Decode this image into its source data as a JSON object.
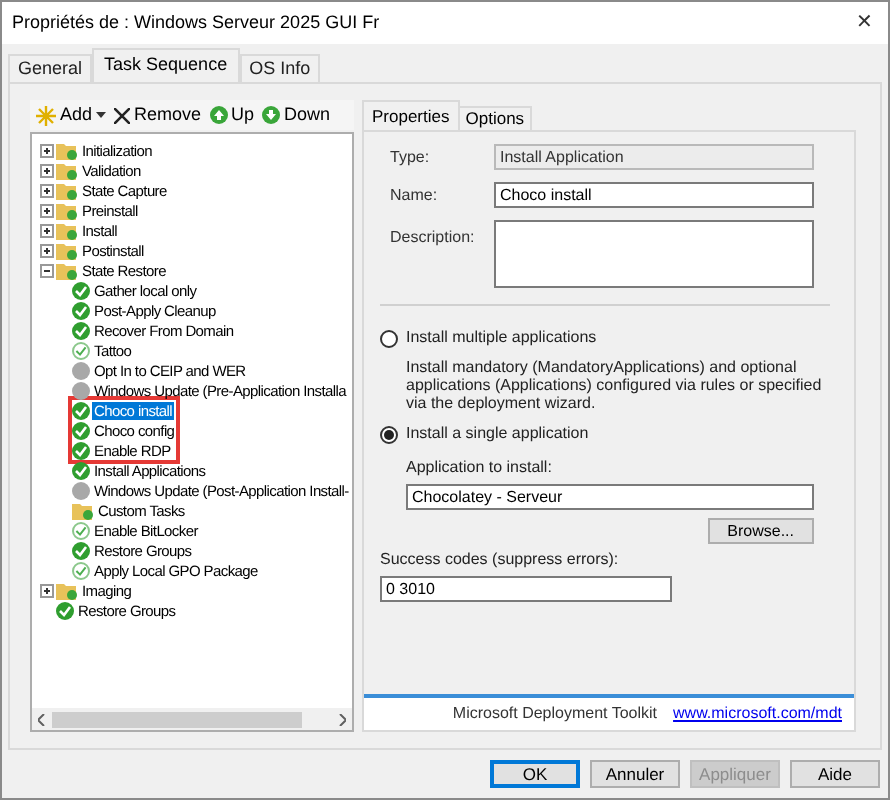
{
  "window": {
    "title": "Propriétés de : Windows Serveur 2025 GUI Fr",
    "close": "✕"
  },
  "tabs": [
    {
      "label": "General",
      "selected": false
    },
    {
      "label": "Task Sequence",
      "selected": true
    },
    {
      "label": "OS Info",
      "selected": false
    }
  ],
  "toolbar": [
    {
      "kind": "add",
      "label": "Add",
      "dropdown": true
    },
    {
      "kind": "remove",
      "label": "Remove"
    },
    {
      "kind": "up",
      "label": "Up"
    },
    {
      "kind": "down",
      "label": "Down"
    }
  ],
  "tree": [
    {
      "label": "Initialization",
      "kind": "folder",
      "expanded": false,
      "selected": false,
      "highlighted": false
    },
    {
      "label": "Validation",
      "kind": "folder",
      "expanded": false,
      "selected": false,
      "highlighted": false
    },
    {
      "label": "State Capture",
      "kind": "folder",
      "expanded": false,
      "selected": false,
      "highlighted": false
    },
    {
      "label": "Preinstall",
      "kind": "folder",
      "expanded": false,
      "selected": false,
      "highlighted": false
    },
    {
      "label": "Install",
      "kind": "folder",
      "expanded": false,
      "selected": false,
      "highlighted": false
    },
    {
      "label": "Postinstall",
      "kind": "folder",
      "expanded": false,
      "selected": false,
      "highlighted": false
    },
    {
      "label": "State Restore",
      "kind": "folder",
      "expanded": true,
      "selected": false,
      "highlighted": false,
      "children": [
        {
          "label": "Gather local only",
          "kind": "check",
          "selected": false,
          "highlighted": false
        },
        {
          "label": "Post-Apply Cleanup",
          "kind": "check",
          "selected": false,
          "highlighted": false
        },
        {
          "label": "Recover From Domain",
          "kind": "check",
          "selected": false,
          "highlighted": false
        },
        {
          "label": "Tattoo",
          "kind": "check-outline",
          "selected": false,
          "highlighted": false
        },
        {
          "label": "Opt In to CEIP and WER",
          "kind": "disabled",
          "selected": false,
          "highlighted": false
        },
        {
          "label": "Windows Update (Pre-Application Installa",
          "kind": "disabled",
          "selected": false,
          "highlighted": false
        },
        {
          "label": "Choco install",
          "kind": "check",
          "selected": true,
          "highlighted": true
        },
        {
          "label": "Choco config",
          "kind": "check",
          "selected": false,
          "highlighted": true
        },
        {
          "label": "Enable RDP",
          "kind": "check",
          "selected": false,
          "highlighted": true
        },
        {
          "label": "Install Applications",
          "kind": "check",
          "selected": false,
          "highlighted": false
        },
        {
          "label": "Windows Update (Post-Application Install-",
          "kind": "disabled",
          "selected": false,
          "highlighted": false
        },
        {
          "label": "Custom Tasks",
          "kind": "folder",
          "selected": false,
          "highlighted": false
        },
        {
          "label": "Enable BitLocker",
          "kind": "check-outline",
          "selected": false,
          "highlighted": false
        },
        {
          "label": "Restore Groups",
          "kind": "check",
          "selected": false,
          "highlighted": false
        },
        {
          "label": "Apply Local GPO Package",
          "kind": "check-outline",
          "selected": false,
          "highlighted": false
        }
      ]
    },
    {
      "label": "Imaging",
      "kind": "folder",
      "expanded": false,
      "selected": false,
      "highlighted": false
    },
    {
      "label": "Restore Groups",
      "kind": "check",
      "selected": false,
      "highlighted": false
    }
  ],
  "right_tabs": [
    {
      "label": "Properties",
      "selected": true
    },
    {
      "label": "Options",
      "selected": false
    }
  ],
  "properties": {
    "type_label": "Type:",
    "type_value": "Install Application",
    "name_label": "Name:",
    "name_value": "Choco install",
    "description_label": "Description:",
    "options": [
      {
        "label": "Install multiple applications",
        "selected": false,
        "description": "Install mandatory (MandatoryApplications) and optional applications (Applications) configured via rules or specified via the deployment wizard."
      },
      {
        "label": "Install a single application",
        "selected": true
      }
    ],
    "application_label": "Application to install:",
    "application_value": "Chocolatey - Serveur",
    "browse": "Browse...",
    "success_label": "Success codes (suppress errors):",
    "success_value": "0 3010"
  },
  "footer": {
    "text": "Microsoft Deployment Toolkit",
    "link": "www.microsoft.com/mdt"
  },
  "buttons": [
    {
      "label": "OK",
      "disabled": false,
      "default": true
    },
    {
      "label": "Annuler",
      "disabled": false,
      "default": false
    },
    {
      "label": "Appliquer",
      "disabled": true,
      "default": false
    },
    {
      "label": "Aide",
      "disabled": false,
      "default": false
    }
  ]
}
